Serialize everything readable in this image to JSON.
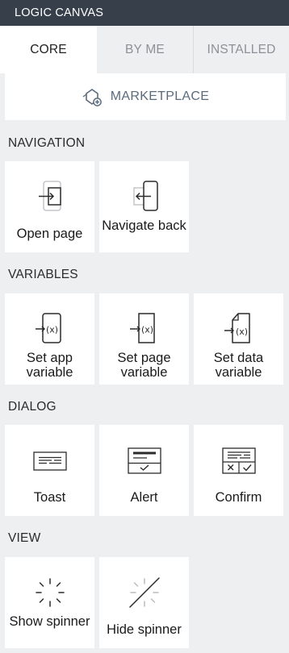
{
  "header": {
    "title": "LOGIC CANVAS"
  },
  "tabs": [
    {
      "label": "CORE",
      "active": true
    },
    {
      "label": "BY ME",
      "active": false
    },
    {
      "label": "INSTALLED",
      "active": false
    }
  ],
  "marketplace": {
    "label": "MARKETPLACE",
    "icon": "marketplace-icon"
  },
  "sections": {
    "navigation": {
      "title": "NAVIGATION",
      "items": [
        {
          "label": "Open page",
          "icon": "open-page-icon"
        },
        {
          "label": "Navigate back",
          "icon": "navigate-back-icon"
        }
      ]
    },
    "variables": {
      "title": "VARIABLES",
      "items": [
        {
          "label": "Set app variable",
          "icon": "set-app-variable-icon"
        },
        {
          "label": "Set page variable",
          "icon": "set-page-variable-icon"
        },
        {
          "label": "Set data variable",
          "icon": "set-data-variable-icon"
        }
      ]
    },
    "dialog": {
      "title": "DIALOG",
      "items": [
        {
          "label": "Toast",
          "icon": "toast-icon"
        },
        {
          "label": "Alert",
          "icon": "alert-icon"
        },
        {
          "label": "Confirm",
          "icon": "confirm-icon"
        }
      ]
    },
    "view": {
      "title": "VIEW",
      "items": [
        {
          "label": "Show spinner",
          "icon": "show-spinner-icon"
        },
        {
          "label": "Hide spinner",
          "icon": "hide-spinner-icon"
        }
      ]
    }
  },
  "colors": {
    "titlebar": "#37404a",
    "background": "#eeeff1",
    "tile": "#ffffff",
    "inactive_tab_text": "#8d9196",
    "marketplace_text": "#5b6b7c"
  }
}
